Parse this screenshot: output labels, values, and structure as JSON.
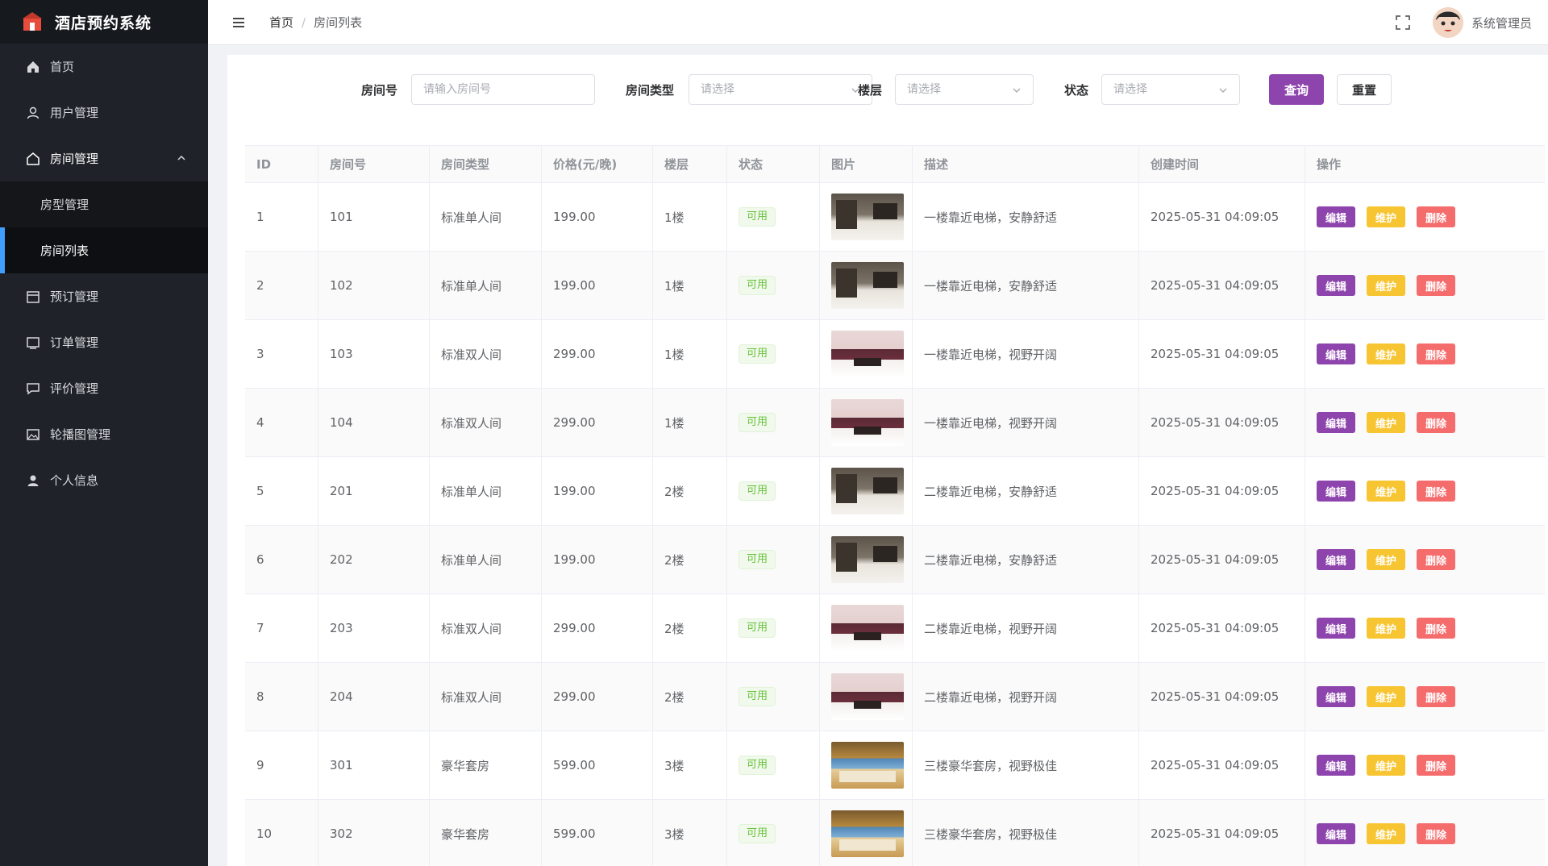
{
  "app": {
    "title": "酒店预约系统"
  },
  "sidebar": {
    "items": [
      {
        "label": "首页",
        "icon": "home-icon"
      },
      {
        "label": "用户管理",
        "icon": "user-icon"
      },
      {
        "label": "房间管理",
        "icon": "house-icon",
        "expanded": true,
        "children": [
          {
            "label": "房型管理"
          },
          {
            "label": "房间列表",
            "active": true
          }
        ]
      },
      {
        "label": "预订管理",
        "icon": "calendar-icon"
      },
      {
        "label": "订单管理",
        "icon": "order-icon"
      },
      {
        "label": "评价管理",
        "icon": "comment-icon"
      },
      {
        "label": "轮播图管理",
        "icon": "image-icon"
      },
      {
        "label": "个人信息",
        "icon": "person-icon"
      }
    ]
  },
  "header": {
    "breadcrumb": {
      "home": "首页",
      "separator": "/",
      "current": "房间列表"
    },
    "user": {
      "name": "系统管理员"
    }
  },
  "search": {
    "room_number": {
      "label": "房间号",
      "placeholder": "请输入房间号"
    },
    "room_type": {
      "label": "房间类型",
      "placeholder": "请选择"
    },
    "floor": {
      "label": "楼层",
      "placeholder": "请选择"
    },
    "status": {
      "label": "状态",
      "placeholder": "请选择"
    },
    "query_label": "查询",
    "reset_label": "重置"
  },
  "table": {
    "columns": [
      "ID",
      "房间号",
      "房间类型",
      "价格(元/晚)",
      "楼层",
      "状态",
      "图片",
      "描述",
      "创建时间",
      "操作"
    ],
    "actions": {
      "edit": "编辑",
      "maintain": "维护",
      "delete": "删除"
    },
    "rows": [
      {
        "id": "1",
        "room": "101",
        "type": "标准单人间",
        "price": "199.00",
        "floor": "1楼",
        "status": "可用",
        "image": "single",
        "desc": "一楼靠近电梯，安静舒适",
        "created": "2025-05-31 04:09:05"
      },
      {
        "id": "2",
        "room": "102",
        "type": "标准单人间",
        "price": "199.00",
        "floor": "1楼",
        "status": "可用",
        "image": "single",
        "desc": "一楼靠近电梯，安静舒适",
        "created": "2025-05-31 04:09:05"
      },
      {
        "id": "3",
        "room": "103",
        "type": "标准双人间",
        "price": "299.00",
        "floor": "1楼",
        "status": "可用",
        "image": "double",
        "desc": "一楼靠近电梯，视野开阔",
        "created": "2025-05-31 04:09:05"
      },
      {
        "id": "4",
        "room": "104",
        "type": "标准双人间",
        "price": "299.00",
        "floor": "1楼",
        "status": "可用",
        "image": "double",
        "desc": "一楼靠近电梯，视野开阔",
        "created": "2025-05-31 04:09:05"
      },
      {
        "id": "5",
        "room": "201",
        "type": "标准单人间",
        "price": "199.00",
        "floor": "2楼",
        "status": "可用",
        "image": "single",
        "desc": "二楼靠近电梯，安静舒适",
        "created": "2025-05-31 04:09:05"
      },
      {
        "id": "6",
        "room": "202",
        "type": "标准单人间",
        "price": "199.00",
        "floor": "2楼",
        "status": "可用",
        "image": "single",
        "desc": "二楼靠近电梯，安静舒适",
        "created": "2025-05-31 04:09:05"
      },
      {
        "id": "7",
        "room": "203",
        "type": "标准双人间",
        "price": "299.00",
        "floor": "2楼",
        "status": "可用",
        "image": "double",
        "desc": "二楼靠近电梯，视野开阔",
        "created": "2025-05-31 04:09:05"
      },
      {
        "id": "8",
        "room": "204",
        "type": "标准双人间",
        "price": "299.00",
        "floor": "2楼",
        "status": "可用",
        "image": "double",
        "desc": "二楼靠近电梯，视野开阔",
        "created": "2025-05-31 04:09:05"
      },
      {
        "id": "9",
        "room": "301",
        "type": "豪华套房",
        "price": "599.00",
        "floor": "3楼",
        "status": "可用",
        "image": "suite",
        "desc": "三楼豪华套房，视野极佳",
        "created": "2025-05-31 04:09:05"
      },
      {
        "id": "10",
        "room": "302",
        "type": "豪华套房",
        "price": "599.00",
        "floor": "3楼",
        "status": "可用",
        "image": "suite",
        "desc": "三楼豪华套房，视野极佳",
        "created": "2025-05-31 04:09:05"
      }
    ]
  },
  "colors": {
    "primary": "#8e44ad",
    "warning": "#f7c531",
    "danger": "#f56c6c",
    "success": "#67c23a",
    "sidebar_bg": "#1f2329"
  }
}
